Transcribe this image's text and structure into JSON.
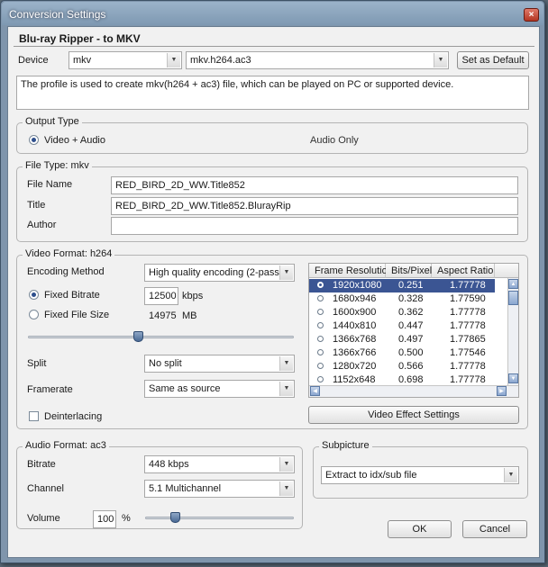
{
  "window": {
    "title": "Conversion Settings",
    "close_label": "×"
  },
  "heading": "Blu-ray Ripper - to MKV",
  "device": {
    "label": "Device",
    "device_value": "mkv",
    "profile_value": "mkv.h264.ac3",
    "set_default_label": "Set as Default",
    "description": "The profile is used to create mkv(h264 + ac3) file, which can be played on PC or supported device."
  },
  "output_type": {
    "title": "Output Type",
    "video_audio_label": "Video + Audio",
    "audio_only_label": "Audio Only",
    "selected": "Video + Audio"
  },
  "file_type": {
    "title": "File Type: mkv",
    "file_name_label": "File Name",
    "file_name_value": "RED_BIRD_2D_WW.Title852",
    "title_label": "Title",
    "title_value": "RED_BIRD_2D_WW.Title852.BlurayRip",
    "author_label": "Author",
    "author_value": ""
  },
  "video_format": {
    "title": "Video Format: h264",
    "encoding_label": "Encoding Method",
    "encoding_value": "High quality encoding (2-pass)",
    "fixed_bitrate_label": "Fixed Bitrate",
    "fixed_bitrate_value": "12500",
    "fixed_bitrate_unit": "kbps",
    "fixed_file_size_label": "Fixed File Size",
    "fixed_file_size_value": "14975",
    "fixed_file_size_unit": "MB",
    "split_label": "Split",
    "split_value": "No split",
    "framerate_label": "Framerate",
    "framerate_value": "Same as source",
    "deinterlacing_label": "Deinterlacing",
    "deinterlacing_checked": false,
    "video_effect_label": "Video Effect Settings"
  },
  "resolution_table": {
    "columns": [
      "Frame Resolution",
      "Bits/Pixel",
      "Aspect Ratio"
    ],
    "rows": [
      [
        "1920x1080",
        "0.251",
        "1.77778"
      ],
      [
        "1680x946",
        "0.328",
        "1.77590"
      ],
      [
        "1600x900",
        "0.362",
        "1.77778"
      ],
      [
        "1440x810",
        "0.447",
        "1.77778"
      ],
      [
        "1366x768",
        "0.497",
        "1.77865"
      ],
      [
        "1366x766",
        "0.500",
        "1.77546"
      ],
      [
        "1280x720",
        "0.566",
        "1.77778"
      ],
      [
        "1152x648",
        "0.698",
        "1.77778"
      ]
    ],
    "selected_row": 0
  },
  "audio_format": {
    "title": "Audio Format: ac3",
    "bitrate_label": "Bitrate",
    "bitrate_value": "448 kbps",
    "channel_label": "Channel",
    "channel_value": "5.1 Multichannel",
    "volume_label": "Volume",
    "volume_value": "100",
    "volume_unit": "%"
  },
  "subpicture": {
    "title": "Subpicture",
    "value": "Extract to idx/sub file"
  },
  "buttons": {
    "ok_label": "OK",
    "cancel_label": "Cancel"
  },
  "colors": {
    "selection": "#3b5593",
    "title_bar": "#8aa3bb"
  }
}
